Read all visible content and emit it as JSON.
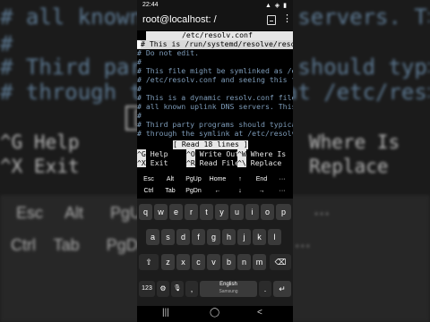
{
  "status_bar": {
    "time": "22:44",
    "icons": "▲ ◈ ▮"
  },
  "app_bar": {
    "title": "root@localhost: /"
  },
  "terminal": {
    "titlebar_left": "  ",
    "filename": "/etc/resolv.conf",
    "lines": [
      "# This is /run/systemd/resolve/resolv.conf",
      "# Do not edit.",
      "#",
      "# This file might be symlinked as /etc/resolv.conf",
      "# /etc/resolv.conf and seeing this text",
      "#",
      "# This is a dynamic resolv.conf file for",
      "# all known uplink DNS servers. This fil",
      "#",
      "# Third party programs should typically",
      "# through the symlink at /etc/resolv.conf"
    ],
    "status_msg": "[ Read 18 lines ]",
    "shortcuts": [
      {
        "key": "^G",
        "label": "Help"
      },
      {
        "key": "^O",
        "label": "Write Out"
      },
      {
        "key": "^W",
        "label": "Where Is"
      },
      {
        "key": "^X",
        "label": "Exit"
      },
      {
        "key": "^R",
        "label": "Read File"
      },
      {
        "key": "^\\",
        "label": "Replace"
      }
    ]
  },
  "extra_keys": {
    "row1": [
      "Esc",
      "Alt",
      "PgUp",
      "Home",
      "↑",
      "End",
      "···"
    ],
    "row2": [
      "Ctrl",
      "Tab",
      "PgDn",
      "←",
      "↓",
      "→",
      "···"
    ]
  },
  "keyboard": {
    "row1": [
      "q",
      "w",
      "e",
      "r",
      "t",
      "y",
      "u",
      "i",
      "o",
      "p"
    ],
    "row2": [
      "a",
      "s",
      "d",
      "f",
      "g",
      "h",
      "j",
      "k",
      "l"
    ],
    "row3": [
      "z",
      "x",
      "c",
      "v",
      "b",
      "n",
      "m"
    ],
    "shift": "⇧",
    "backspace": "⌫",
    "num": "123",
    "settings": "⚙",
    "mic": "🎙",
    "comma": ",",
    "space_label": "English",
    "space_sub": "Samsung",
    "period": ".",
    "enter": "↵"
  },
  "nav_bar": {
    "recents": "|||",
    "home": "◯",
    "back": "<"
  },
  "background": {
    "line1": "# all known uplink DNS servers. T>",
    "line2": "#",
    "line3": "# Third party programs should typ>",
    "line4": "# through the symlink at /etc/res>",
    "read_lines": "[ R",
    "help1": "^G Help",
    "whereis": "Where Is",
    "help2": "^X Exit",
    "replace": "Replace",
    "row_a": "Esc     Alt      PgUp                      End        ···",
    "row_b": "Ctrl    Tab      PgDn                                 ···"
  }
}
